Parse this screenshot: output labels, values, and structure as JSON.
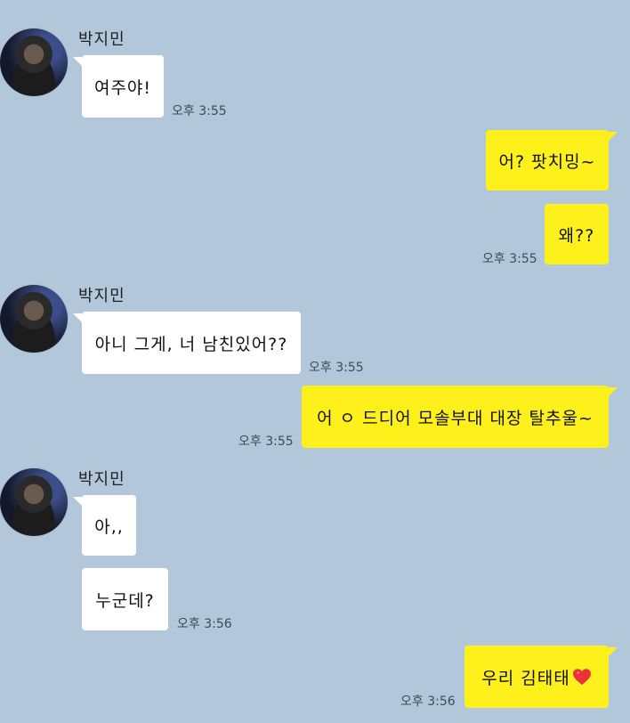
{
  "chat": {
    "messages": [
      {
        "sender": "박지민",
        "text": "여주야!",
        "time": "오후 3:55"
      },
      {
        "text": "어? 팟치밍~"
      },
      {
        "text": "왜??",
        "time": "오후 3:55"
      },
      {
        "sender": "박지민",
        "text": "아니 그게, 너 남친있어??",
        "time": "오후 3:55"
      },
      {
        "text": "어 ㅇ 드디어 모솔부대 대장 탈추울~",
        "time": "오후 3:55"
      },
      {
        "sender": "박지민",
        "text": "아,,"
      },
      {
        "text": "누군데?",
        "time": "오후 3:56"
      },
      {
        "text": "우리 김태태",
        "time": "오후 3:56"
      }
    ]
  },
  "icons": {
    "heart": "heart-icon"
  },
  "colors": {
    "background": "#b2c7da",
    "outgoing_bubble": "#fef01b",
    "incoming_bubble": "#ffffff",
    "heart": "#e8323c"
  }
}
